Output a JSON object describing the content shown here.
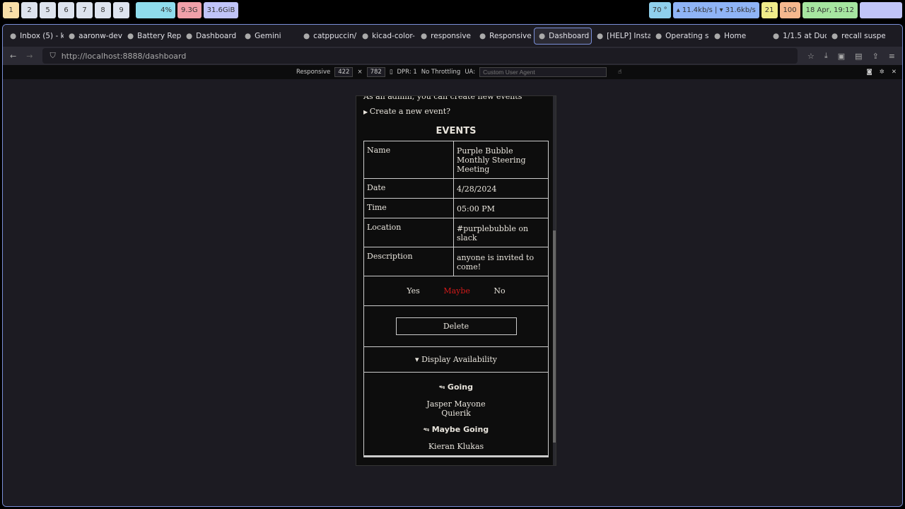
{
  "system_bar": {
    "workspaces": [
      "1",
      "2",
      "5",
      "6",
      "7",
      "8",
      "9"
    ],
    "battery": "4%",
    "memory": "9.3G",
    "disk": "31.6GiB",
    "weather": "70 °",
    "network": "▴ 11.4kb/s | ▾ 31.6kb/s",
    "updates": "21",
    "volume": "100",
    "datetime": "18 Apr, 19:12"
  },
  "browser": {
    "tabs": [
      "Inbox (5) - k",
      "aaronw-dev",
      "Battery Rep",
      "Dashboard",
      "Gemini",
      "catppuccin/",
      "kicad-color-",
      "responsive",
      "Responsive",
      "Dashboard",
      "[HELP] Insta",
      "Operating s",
      "Home",
      "1/1.5 at Duc",
      "recall suspe"
    ],
    "url": "http://localhost:8888/dashboard"
  },
  "rdm": {
    "preset": "Responsive",
    "width": "422",
    "height": "782",
    "dpr": "DPR: 1",
    "throttling": "No Throttling",
    "ua_label": "UA:",
    "ua_placeholder": "Custom User Agent"
  },
  "page": {
    "admin_note": "As an admin, you can create new events",
    "create_summary": "Create a new event?",
    "events_heading": "EVENTS",
    "rows": [
      {
        "label": "Name",
        "value": "Purple Bubble Monthly Steering Meeting"
      },
      {
        "label": "Date",
        "value": "4/28/2024"
      },
      {
        "label": "Time",
        "value": "05:00 PM"
      },
      {
        "label": "Location",
        "value": "#purplebubble on slack"
      },
      {
        "label": "Description",
        "value": "anyone is invited to come!"
      }
    ],
    "rsvp": {
      "yes": "Yes",
      "maybe": "Maybe",
      "no": "No",
      "selected": "Maybe",
      "selected_color": "#d11a1a"
    },
    "delete": "Delete",
    "availability": "Display Availability",
    "going_heading": "Going",
    "going": [
      "Jasper Mayone",
      "Quierik"
    ],
    "maybe_heading": "Maybe Going",
    "maybe_going": [
      "Kieran Klukas"
    ]
  }
}
